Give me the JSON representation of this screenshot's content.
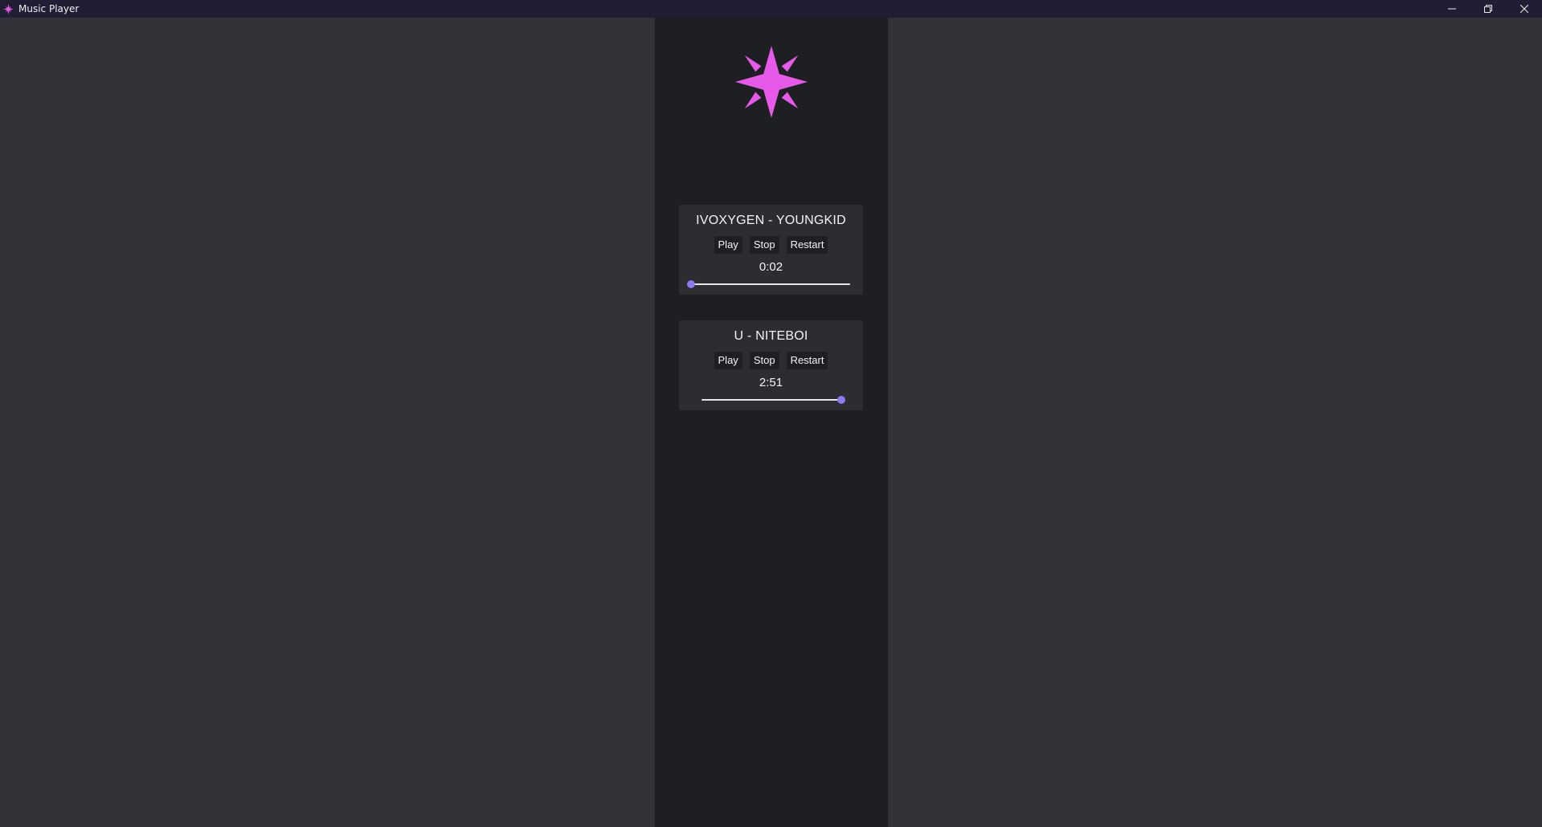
{
  "window": {
    "title": "Music Player",
    "icon": "pink-star-icon"
  },
  "colors": {
    "titlebar": "#1f1e33",
    "background": "#313338",
    "column": "#1e1f22",
    "card": "#2b2d31",
    "logo": "#e759e8",
    "slider_thumb": "#8c7cf0"
  },
  "logo": {
    "icon": "pink-star-logo"
  },
  "tracks": [
    {
      "title": "IVOXYGEN - YOUNGKID",
      "play_label": "Play",
      "stop_label": "Stop",
      "restart_label": "Restart",
      "time": "0:02",
      "progress": 0.01
    },
    {
      "title": "U - NITEBOI",
      "play_label": "Play",
      "stop_label": "Stop",
      "restart_label": "Restart",
      "time": "2:51",
      "progress": 1.0
    }
  ]
}
